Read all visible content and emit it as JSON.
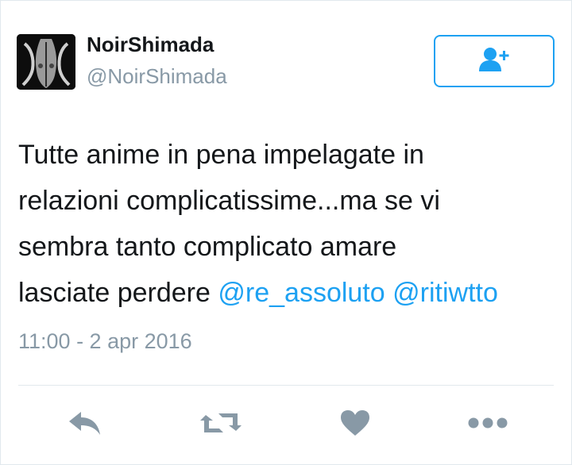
{
  "tweet": {
    "author_name": "NoirShimada",
    "author_handle": "@NoirShimada",
    "text_lines": [
      "Tutte anime in pena impelagate in",
      "relazioni complicatissime...ma se vi",
      "sembra tanto complicato amare",
      "lasciate perdere "
    ],
    "mentions": [
      "@re_assoluto",
      "@ritiwtto"
    ],
    "timestamp": "11:00 - 2 apr 2016"
  },
  "icons": {
    "follow": "add-user-icon",
    "reply": "reply-icon",
    "retweet": "retweet-icon",
    "like": "heart-icon",
    "more": "more-icon"
  },
  "colors": {
    "accent": "#1da1f2",
    "icon_gray": "#8899a6",
    "text": "#14171a",
    "secondary_text": "#8899a6"
  }
}
